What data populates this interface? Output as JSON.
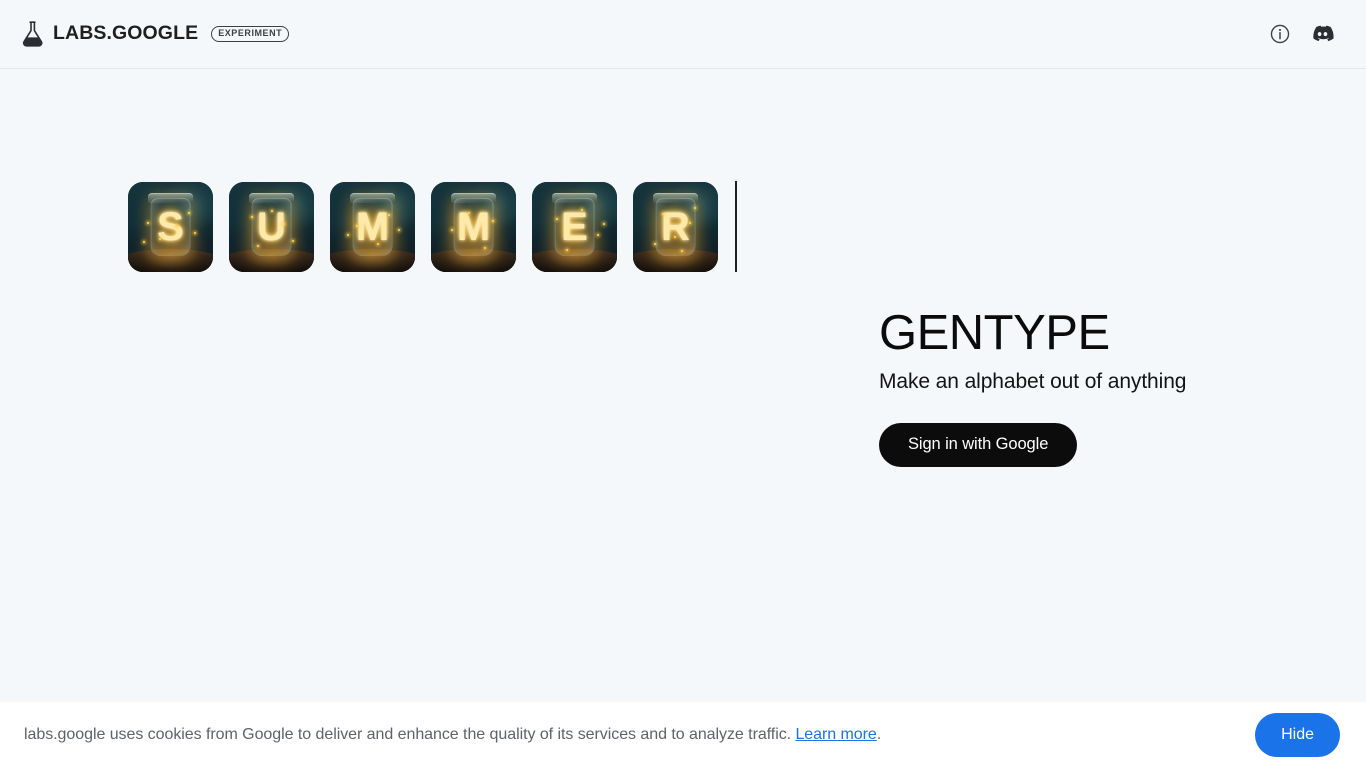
{
  "header": {
    "logo_icon": "flask-icon",
    "wordmark": "LABS.GOOGLE",
    "badge": "EXPERIMENT",
    "actions": [
      {
        "name": "info-icon",
        "label": "Info"
      },
      {
        "name": "discord-icon",
        "label": "Discord"
      }
    ]
  },
  "main": {
    "tiles": [
      {
        "letter": "S",
        "alt": "Glowing letter S inside a firefly mason jar"
      },
      {
        "letter": "U",
        "alt": "Glowing letter U inside a firefly mason jar"
      },
      {
        "letter": "M",
        "alt": "Glowing letter M inside a firefly mason jar"
      },
      {
        "letter": "M",
        "alt": "Glowing letter M inside a firefly mason jar"
      },
      {
        "letter": "E",
        "alt": "Glowing letter E inside a firefly mason jar"
      },
      {
        "letter": "R",
        "alt": "Glowing letter R inside a firefly mason jar"
      }
    ],
    "word": "SUMMER",
    "caret_visible": true,
    "hero": {
      "title": "GENTYPE",
      "subtitle": "Make an alphabet out of anything",
      "signin_label": "Sign in with Google"
    }
  },
  "cookie_banner": {
    "text_before": "labs.google uses cookies from Google to deliver and enhance the quality of its services and to analyze traffic. ",
    "link_label": "Learn more",
    "text_after": ".",
    "hide_label": "Hide"
  },
  "colors": {
    "page_background": "#f4f8fb",
    "header_border": "#e3e7ec",
    "text_primary": "#1f1f1f",
    "accent_blue": "#1a73e8",
    "button_black": "#0c0c0c",
    "banner_background": "#ffffff",
    "cookie_text": "#5f6368",
    "glyph_glow": "#f5a623"
  }
}
